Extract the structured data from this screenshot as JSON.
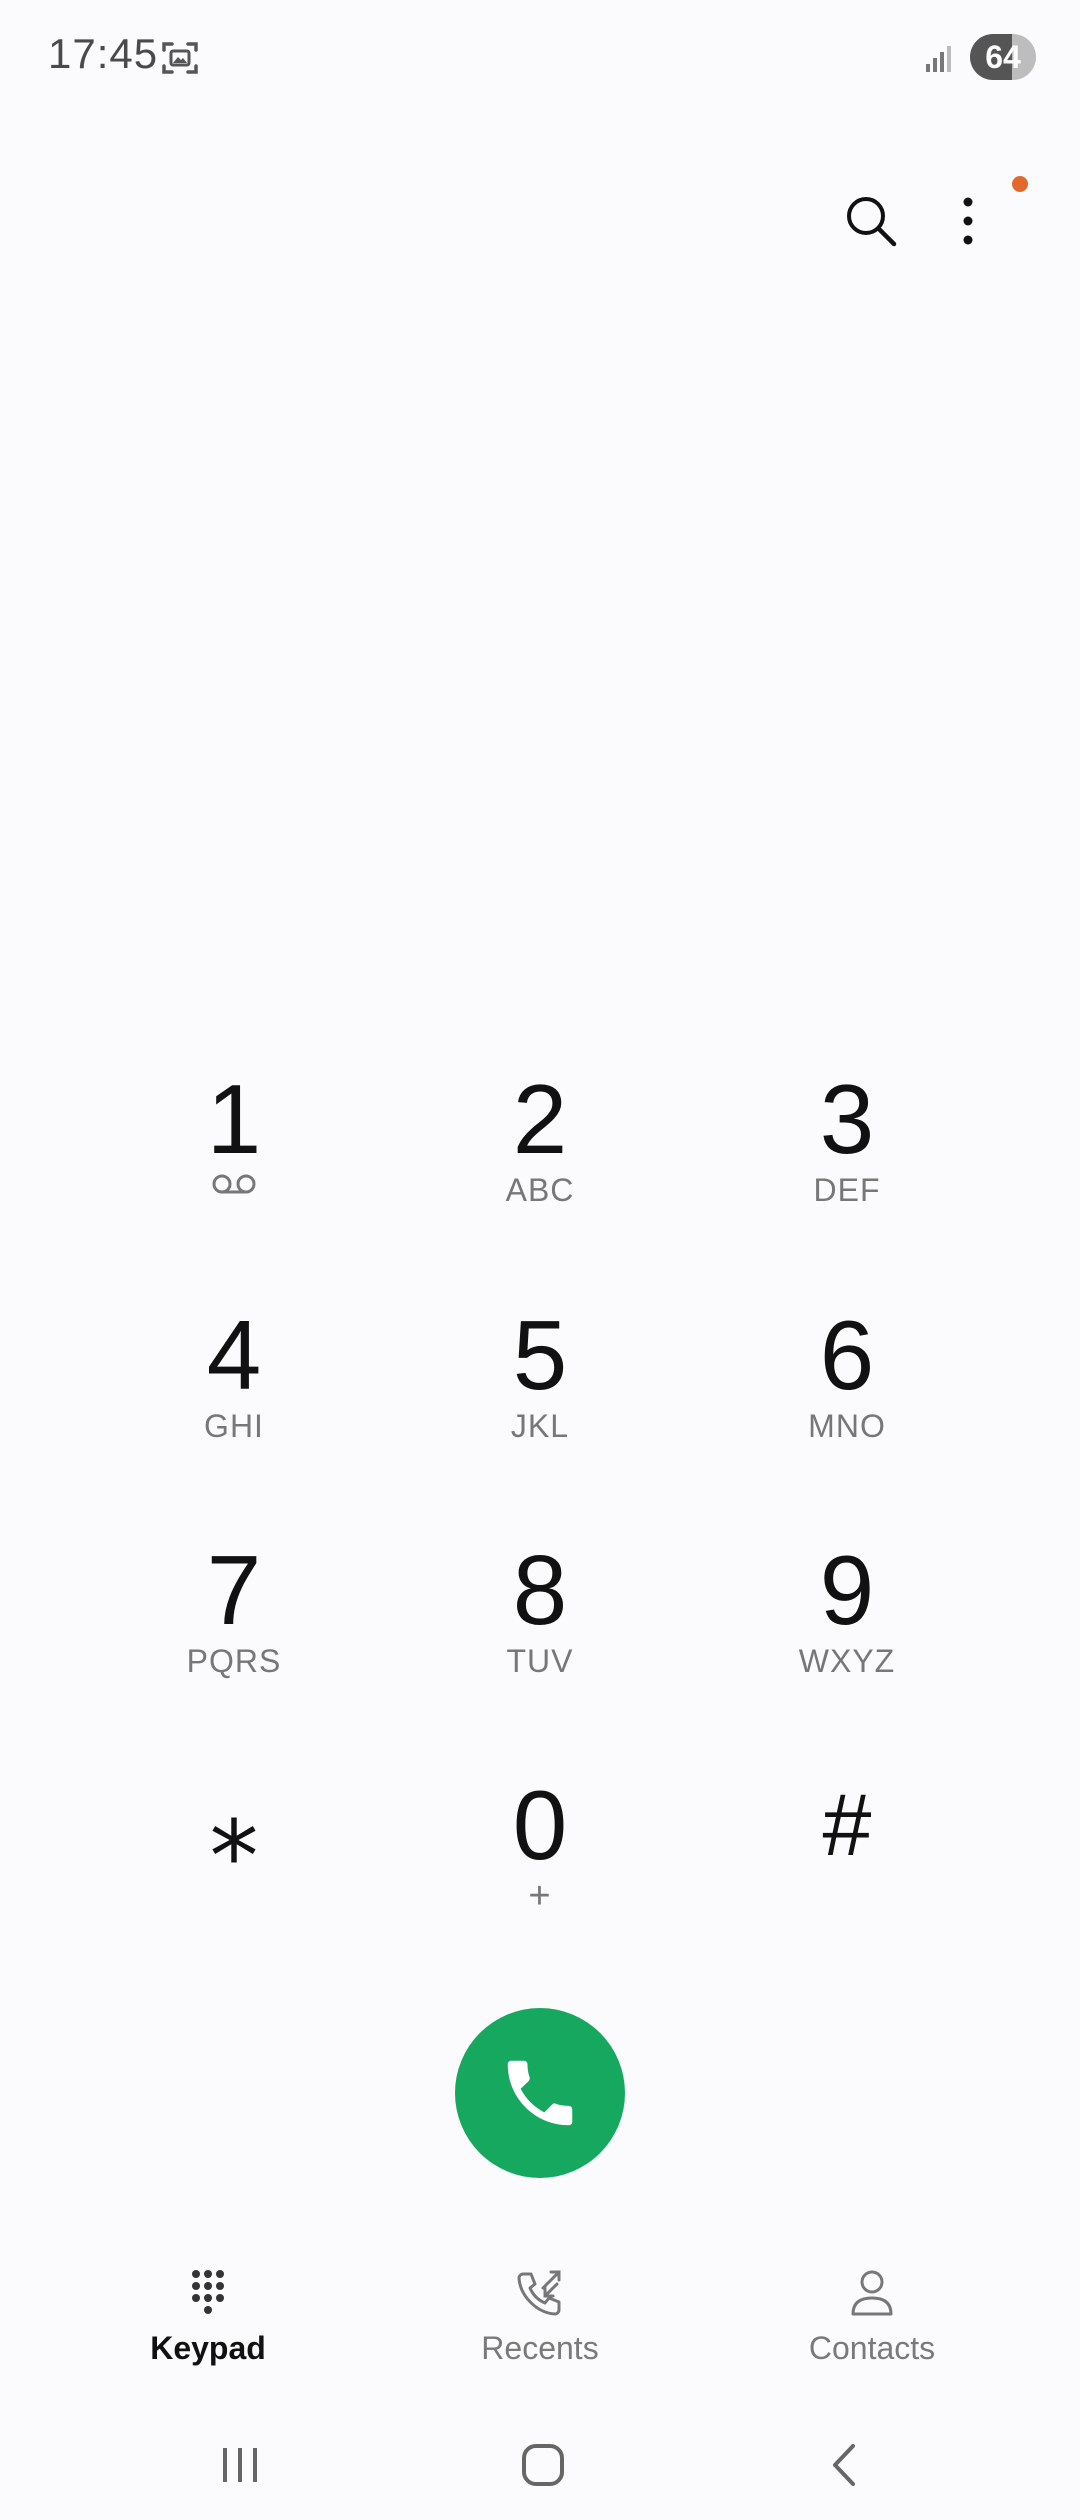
{
  "status_bar": {
    "time": "17:45",
    "battery_level": "64",
    "icons": [
      "screenshot-icon",
      "signal-icon"
    ]
  },
  "top_actions": {
    "icons": [
      "search-icon",
      "more-options-icon"
    ],
    "notification_dot_color": "#e2692e"
  },
  "keypad": {
    "keys": [
      {
        "digit": "1",
        "letters": "",
        "icon": "voicemail-icon"
      },
      {
        "digit": "2",
        "letters": "ABC"
      },
      {
        "digit": "3",
        "letters": "DEF"
      },
      {
        "digit": "4",
        "letters": "GHI"
      },
      {
        "digit": "5",
        "letters": "JKL"
      },
      {
        "digit": "6",
        "letters": "MNO"
      },
      {
        "digit": "7",
        "letters": "PQRS"
      },
      {
        "digit": "8",
        "letters": "TUV"
      },
      {
        "digit": "9",
        "letters": "WXYZ"
      },
      {
        "digit": "⁎",
        "letters": ""
      },
      {
        "digit": "0",
        "letters": "+"
      },
      {
        "digit": "#",
        "letters": ""
      }
    ]
  },
  "call_button": {
    "icon": "phone-icon",
    "color": "#16a85f"
  },
  "tabs": [
    {
      "label": "Keypad",
      "icon": "keypad-icon",
      "active": true
    },
    {
      "label": "Recents",
      "icon": "recents-icon",
      "active": false
    },
    {
      "label": "Contacts",
      "icon": "contacts-icon",
      "active": false
    }
  ],
  "navbar": {
    "icons": [
      "recent-apps-icon",
      "home-icon",
      "back-icon"
    ]
  }
}
